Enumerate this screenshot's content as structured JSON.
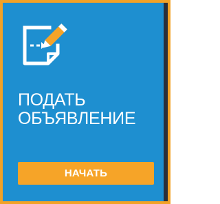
{
  "card": {
    "icon": "edit-document-icon",
    "title_line1": "ПОДАТЬ",
    "title_line2": "ОБЪЯВЛЕНИЕ",
    "button_label": "НАЧАТЬ"
  },
  "colors": {
    "background": "#1e8fd0",
    "border": "#f2a227",
    "button": "#f6a428",
    "text": "#ffffff"
  }
}
